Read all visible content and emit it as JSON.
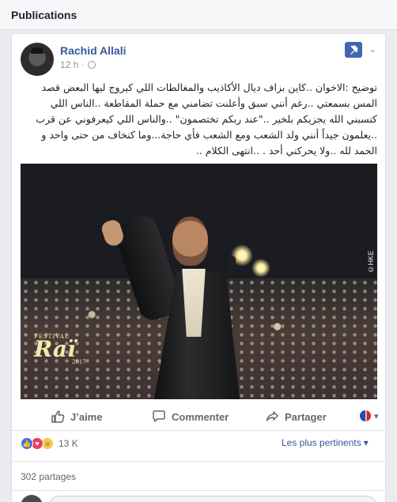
{
  "section": {
    "title": "Publications"
  },
  "post": {
    "author": "Rachid Allali",
    "time": "12 h",
    "separator": "·",
    "text": "توضيح :الاخوان ..كاين بزاف ديال الأكاذيب والمغالطات اللي كيروج ليها البعض قصد المس بسمعتي ..رغم أنني سبق وأعلنت تضامني مع حملة المقاطعة ..الناس اللي كتسبني الله يجزيكم بلخير ..\"عند ربكم تختصمون\" ..والناس اللي كيعرفوني عن قرب ..يعلمون جيداً أنني ولد الشعب ومع الشعب فأي حاجة...وما كنخاف من حتى واحد و الحمد لله ..ولا يحركني أحد . ..انتهى الكلام ..",
    "image": {
      "festival": "FESTIVAL",
      "brand": "Raï",
      "year": "2017",
      "watermark": "©HKE"
    },
    "actions": {
      "like": "J’aime",
      "comment": "Commenter",
      "share": "Partager"
    },
    "stats": {
      "reactions": "13 K",
      "sort": "Les plus pertinents",
      "shares": "302 partages"
    },
    "colors": {
      "link": "#365899",
      "primary": "#4267b2",
      "muted": "#90949c"
    }
  }
}
